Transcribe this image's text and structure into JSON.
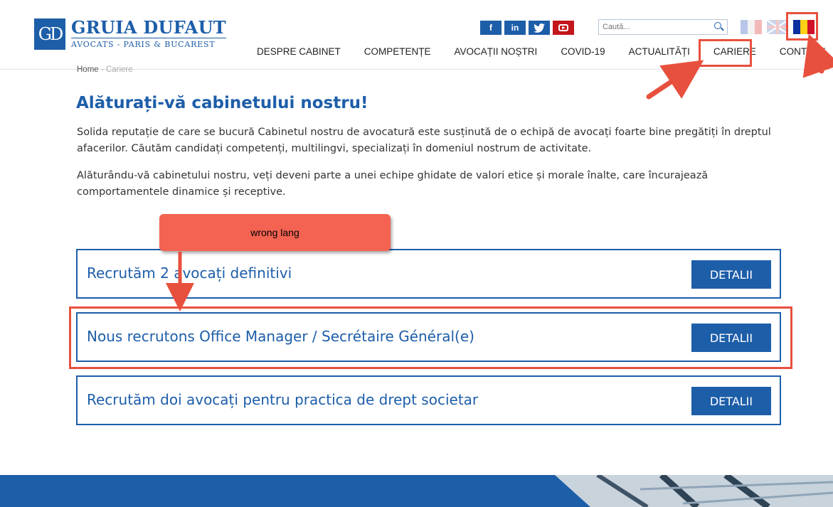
{
  "logo": {
    "mark": "GD",
    "name": "GRUIA DUFAUT",
    "subtitle": "AVOCATS - PARIS & BUCAREST"
  },
  "socials": [
    "facebook-icon",
    "linkedin-icon",
    "twitter-icon",
    "youtube-icon"
  ],
  "social_glyphs": {
    "facebook": "f",
    "linkedin": "in"
  },
  "search": {
    "placeholder": "Caută..."
  },
  "languages": [
    "fr",
    "en",
    "ro"
  ],
  "nav": {
    "items": [
      {
        "label": "DESPRE CABINET"
      },
      {
        "label": "COMPETENȚE"
      },
      {
        "label": "AVOCAȚII NOȘTRI"
      },
      {
        "label": "COVID-19"
      },
      {
        "label": "ACTUALITĂȚI"
      },
      {
        "label": "CARIERE"
      },
      {
        "label": "CONTACT"
      }
    ]
  },
  "breadcrumb": {
    "home": "Home",
    "separator": "-",
    "current": "Cariere"
  },
  "page": {
    "title": "Alăturați-vă cabinetului nostru!",
    "paragraphs": [
      "Solida reputație de care se bucură Cabinetul nostru de avocatură este susținută de o echipă de avocați foarte bine pregătiți în dreptul afacerilor. Căutăm candidați competenți, multilingvi, specializați în domeniul nostrum de activitate.",
      "Alăturându-vă cabinetului nostru, veți deveni parte a unei echipe ghidate de valori etice și morale înalte, care încurajează comportamentele dinamice și receptive."
    ]
  },
  "jobs": [
    {
      "title": "Recrutăm 2 avocați definitivi",
      "button": "DETALII"
    },
    {
      "title": "Nous recrutons Office Manager / Secrétaire Général(e)",
      "button": "DETALII"
    },
    {
      "title": "Recrutăm doi avocați pentru practica de drept societar",
      "button": "DETALII"
    }
  ],
  "annotation": {
    "callout": "wrong lang"
  },
  "colors": {
    "brand": "#1d5ea9",
    "annotation": "#e8503e",
    "callout": "#f46352"
  }
}
